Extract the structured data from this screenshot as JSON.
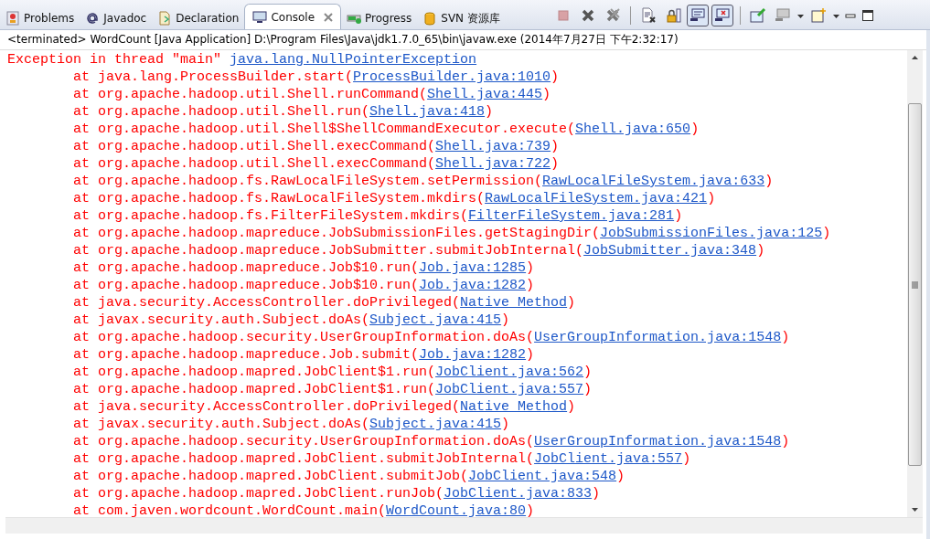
{
  "tabs": [
    {
      "label": "Problems",
      "kind": "problems",
      "selected": false
    },
    {
      "label": "Javadoc",
      "kind": "at",
      "selected": false
    },
    {
      "label": "Declaration",
      "kind": "declaration",
      "selected": false
    },
    {
      "label": "Console",
      "kind": "console",
      "selected": true
    },
    {
      "label": "Progress",
      "kind": "progress",
      "selected": false
    },
    {
      "label": "SVN 资源库",
      "kind": "svn",
      "selected": false
    }
  ],
  "toolbar": [
    {
      "kind": "terminate",
      "disabled": true,
      "pressed": false
    },
    {
      "kind": "remove",
      "disabled": false,
      "pressed": false
    },
    {
      "kind": "remove-all",
      "disabled": false,
      "pressed": false
    },
    {
      "kind": "sep"
    },
    {
      "kind": "clear",
      "disabled": false,
      "pressed": false
    },
    {
      "kind": "lock",
      "disabled": false,
      "pressed": false
    },
    {
      "kind": "stdout",
      "disabled": false,
      "pressed": true
    },
    {
      "kind": "stderr",
      "disabled": false,
      "pressed": true
    },
    {
      "kind": "sep"
    },
    {
      "kind": "pin",
      "disabled": false,
      "pressed": false
    },
    {
      "kind": "display",
      "disabled": false,
      "pressed": false
    },
    {
      "kind": "dropdown"
    },
    {
      "kind": "new",
      "disabled": false,
      "pressed": false
    },
    {
      "kind": "dropdown"
    },
    {
      "kind": "minimize"
    },
    {
      "kind": "maximize"
    }
  ],
  "status": "<terminated> WordCount [Java Application] D:\\Program Files\\Java\\jdk1.7.0_65\\bin\\javaw.exe (2014年7月27日 下午2:32:17)",
  "exception": {
    "text": "Exception in thread \"main\" ",
    "link": "java.lang.NullPointerException"
  },
  "frames": [
    {
      "call": "at java.lang.ProcessBuilder.start(",
      "link": "ProcessBuilder.java:1010",
      "close": ")"
    },
    {
      "call": "at org.apache.hadoop.util.Shell.runCommand(",
      "link": "Shell.java:445",
      "close": ")"
    },
    {
      "call": "at org.apache.hadoop.util.Shell.run(",
      "link": "Shell.java:418",
      "close": ")"
    },
    {
      "call": "at org.apache.hadoop.util.Shell$ShellCommandExecutor.execute(",
      "link": "Shell.java:650",
      "close": ")"
    },
    {
      "call": "at org.apache.hadoop.util.Shell.execCommand(",
      "link": "Shell.java:739",
      "close": ")"
    },
    {
      "call": "at org.apache.hadoop.util.Shell.execCommand(",
      "link": "Shell.java:722",
      "close": ")"
    },
    {
      "call": "at org.apache.hadoop.fs.RawLocalFileSystem.setPermission(",
      "link": "RawLocalFileSystem.java:633",
      "close": ")"
    },
    {
      "call": "at org.apache.hadoop.fs.RawLocalFileSystem.mkdirs(",
      "link": "RawLocalFileSystem.java:421",
      "close": ")"
    },
    {
      "call": "at org.apache.hadoop.fs.FilterFileSystem.mkdirs(",
      "link": "FilterFileSystem.java:281",
      "close": ")"
    },
    {
      "call": "at org.apache.hadoop.mapreduce.JobSubmissionFiles.getStagingDir(",
      "link": "JobSubmissionFiles.java:125",
      "close": ")"
    },
    {
      "call": "at org.apache.hadoop.mapreduce.JobSubmitter.submitJobInternal(",
      "link": "JobSubmitter.java:348",
      "close": ")"
    },
    {
      "call": "at org.apache.hadoop.mapreduce.Job$10.run(",
      "link": "Job.java:1285",
      "close": ")"
    },
    {
      "call": "at org.apache.hadoop.mapreduce.Job$10.run(",
      "link": "Job.java:1282",
      "close": ")"
    },
    {
      "call": "at java.security.AccessController.doPrivileged(",
      "link": "Native Method",
      "close": ")"
    },
    {
      "call": "at javax.security.auth.Subject.doAs(",
      "link": "Subject.java:415",
      "close": ")"
    },
    {
      "call": "at org.apache.hadoop.security.UserGroupInformation.doAs(",
      "link": "UserGroupInformation.java:1548",
      "close": ")"
    },
    {
      "call": "at org.apache.hadoop.mapreduce.Job.submit(",
      "link": "Job.java:1282",
      "close": ")"
    },
    {
      "call": "at org.apache.hadoop.mapred.JobClient$1.run(",
      "link": "JobClient.java:562",
      "close": ")"
    },
    {
      "call": "at org.apache.hadoop.mapred.JobClient$1.run(",
      "link": "JobClient.java:557",
      "close": ")"
    },
    {
      "call": "at java.security.AccessController.doPrivileged(",
      "link": "Native Method",
      "close": ")"
    },
    {
      "call": "at javax.security.auth.Subject.doAs(",
      "link": "Subject.java:415",
      "close": ")"
    },
    {
      "call": "at org.apache.hadoop.security.UserGroupInformation.doAs(",
      "link": "UserGroupInformation.java:1548",
      "close": ")"
    },
    {
      "call": "at org.apache.hadoop.mapred.JobClient.submitJobInternal(",
      "link": "JobClient.java:557",
      "close": ")"
    },
    {
      "call": "at org.apache.hadoop.mapred.JobClient.submitJob(",
      "link": "JobClient.java:548",
      "close": ")"
    },
    {
      "call": "at org.apache.hadoop.mapred.JobClient.runJob(",
      "link": "JobClient.java:833",
      "close": ")"
    },
    {
      "call": "at com.javen.wordcount.WordCount.main(",
      "link": "WordCount.java:80",
      "close": ")"
    }
  ]
}
